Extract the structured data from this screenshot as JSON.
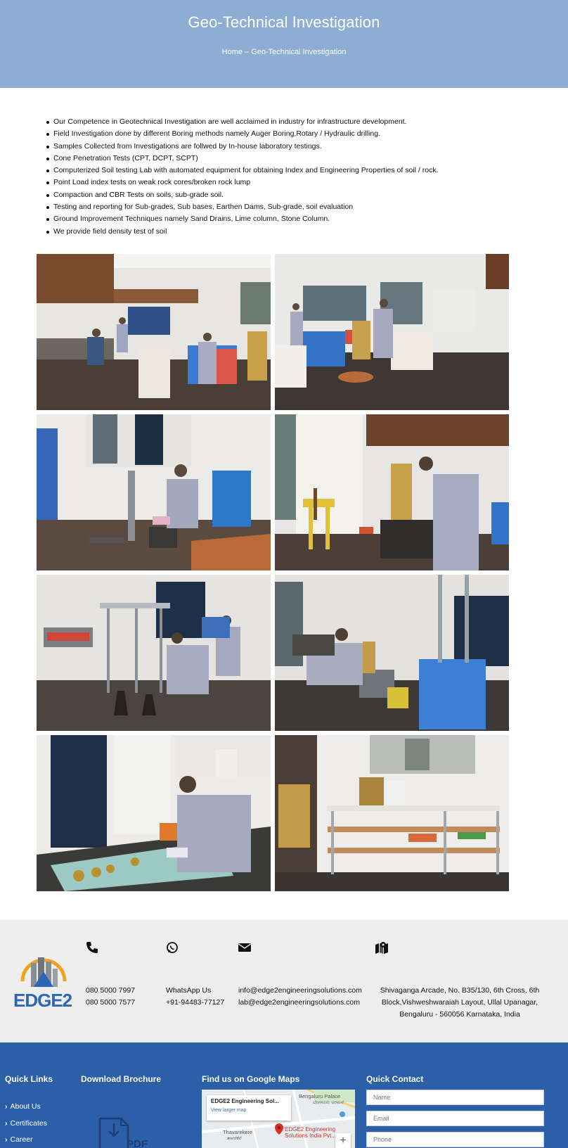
{
  "hero": {
    "title": "Geo-Technical Investigation",
    "breadcrumb_home": "Home",
    "breadcrumb_sep": " – ",
    "breadcrumb_current": "Geo-Technical Investigation"
  },
  "services": [
    "Our Competence in Geotechnical Investigation are well acclaimed in industry for infrastructure development.",
    "Field Investigation done by different Boring methods namely Auger Boring,Rotary / Hydraulic drilling.",
    "Samples Collected from Investigations are follwed by In-house laboratory testings.",
    "Cone Penetration Tests (CPT, DCPT, SCPT)",
    "Computerized Soil testing Lab with automated equipment for obtaining Index and Engineering Properties of soil / rock.",
    "Point Load index tests on weak rock cores/broken rock lump",
    "Compaction and CBR Tests on soils, sub-grade soil.",
    "Testing and reporting for Sub-grades, Sub bases, Earthen Dams, Sub-grade, soil evaluation",
    "Ground Improvement Techniques namely Sand Drains, Lime column, Stone Column.",
    "We provide field density test of soil"
  ],
  "gallery": {
    "photos": [
      "lab-photo-1",
      "lab-photo-2",
      "lab-photo-3",
      "lab-photo-4",
      "lab-photo-5",
      "lab-photo-6",
      "lab-photo-7",
      "lab-photo-8"
    ]
  },
  "contact": {
    "logo_text": "EDGE2",
    "icons": [
      "phone-icon",
      "whatsapp-icon",
      "envelope-icon",
      "map-marker-icon"
    ],
    "phone_1": "080 5000 7997",
    "phone_2": "080 5000 7577",
    "whatsapp_label": "WhatsApp Us",
    "whatsapp_number": "+91-94483-77127",
    "email_1": "info@edge2engineeringsolutions.com",
    "email_2": "lab@edge2engineeringsolutions.com",
    "address_line_1": "Shivaganga Arcade, No. B35/130, 6th Cross, 6th",
    "address_line_2": "Block,Vishweshwaraiah Layout, Ullal Upanagar,",
    "address_line_3": "Bengaluru - 560056 Karnataka, India"
  },
  "footer": {
    "quick_links_title": "Quick Links",
    "quick_links": [
      "About Us",
      "Certificates",
      "Career"
    ],
    "brochure_title": "Download Brochure",
    "brochure_icon_text": "PDF",
    "maps_title": "Find us on Google Maps",
    "map": {
      "place_title": "EDGE2 Engineering Sol...",
      "larger_map_link": "View larger map",
      "label_palace": "Bengaluru Palace",
      "label_palace_local": "ಬೆಂಗಳೂರು ಅರಮನೆ",
      "label_thavarekere": "Thavarekere",
      "label_thavarekere_local": "ತಾವರೆಕೆರೆ",
      "business_line_1": "EDGE2 Engineering",
      "business_line_2": "Solutions India Pvt...",
      "zoom_in": "+"
    },
    "quick_contact_title": "Quick Contact",
    "form": {
      "name_placeholder": "Name",
      "email_placeholder": "Email",
      "phone_placeholder": "Phone"
    }
  },
  "colors": {
    "hero_bg": "#8dadd3",
    "footer_bg": "#2b5fa7",
    "contact_bg": "#eeeeee",
    "brand_blue": "#2e66b7",
    "brand_orange": "#f2a21b"
  }
}
